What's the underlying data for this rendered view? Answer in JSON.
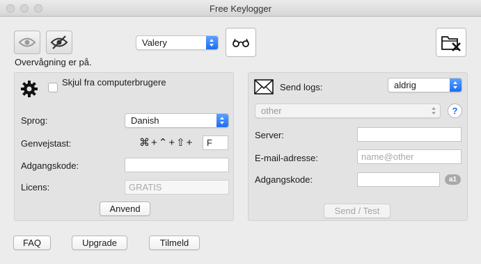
{
  "window": {
    "title": "Free Keylogger"
  },
  "top": {
    "status_text": "Overvågning er på.",
    "user_select": "Valery",
    "eye_icon": "eye-icon",
    "eye_off_icon": "eye-off-icon",
    "glasses_icon": "glasses-icon",
    "clear_folder_icon": "folder-delete-icon"
  },
  "settings": {
    "hide_label": "Skjul fra computerbrugere",
    "language_label": "Sprog:",
    "language_value": "Danish",
    "hotkey_label": "Genvejstast:",
    "hotkey_combo": "⌘+⌃+⇧+",
    "hotkey_key": "F",
    "password_label": "Adgangskode:",
    "password_value": "",
    "license_label": "Licens:",
    "license_value": "GRATIS",
    "apply_label": "Anvend"
  },
  "email": {
    "send_logs_label": "Send logs:",
    "send_logs_value": "aldrig",
    "provider_value": "other",
    "help_label": "?",
    "server_label": "Server:",
    "server_value": "",
    "address_label": "E-mail-adresse:",
    "address_placeholder": "name@other",
    "password_label": "Adgangskode:",
    "password_value": "",
    "password_badge": "a1",
    "send_test_label": "Send / Test"
  },
  "footer": {
    "faq_label": "FAQ",
    "upgrade_label": "Upgrade",
    "signup_label": "Tilmeld"
  },
  "colors": {
    "accent": "#1d6cf2",
    "window_bg": "#ececec",
    "panel_bg": "#e3e3e3"
  }
}
